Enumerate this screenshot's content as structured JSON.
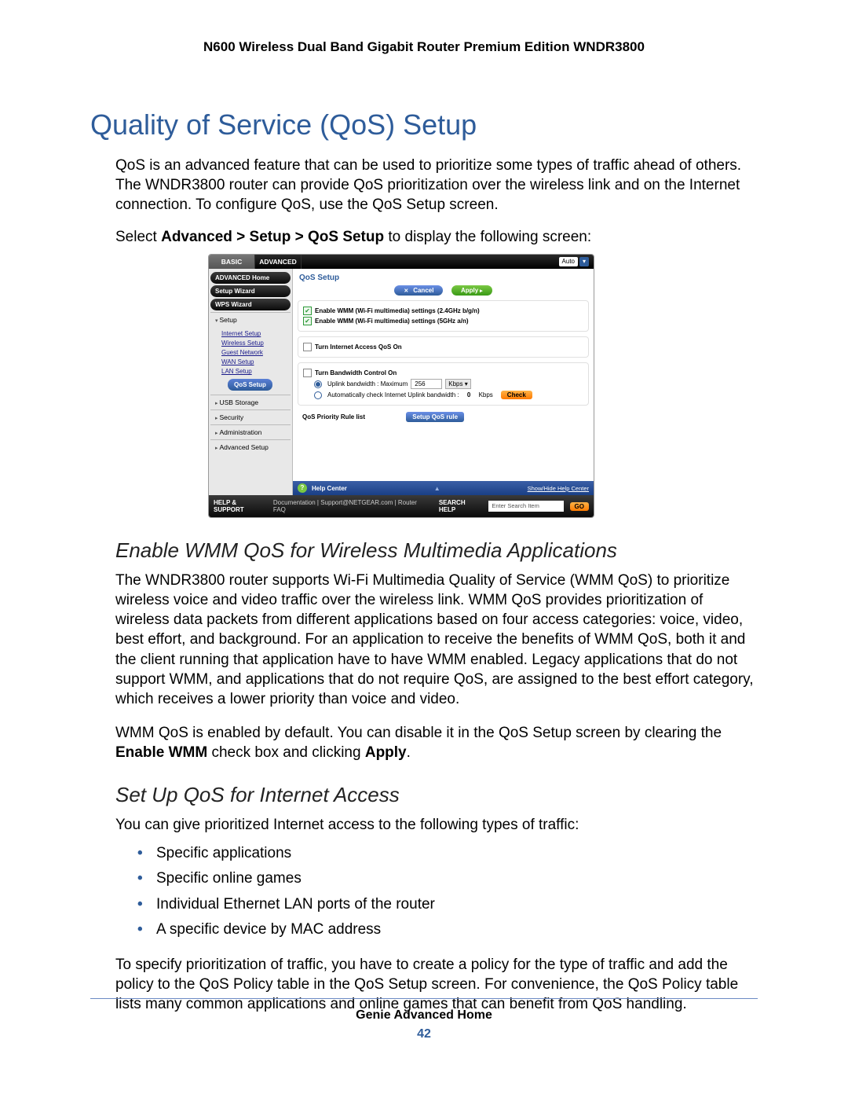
{
  "doc_header": "N600 Wireless Dual Band Gigabit Router Premium Edition WNDR3800",
  "page_title": "Quality of Service (QoS) Setup",
  "intro": "QoS is an advanced feature that can be used to prioritize some types of traffic ahead of others. The WNDR3800 router can provide QoS prioritization over the wireless link and on the Internet connection. To configure QoS, use the QoS Setup screen.",
  "nav_pre": "Select ",
  "nav_bold": "Advanced > Setup > QoS Setup",
  "nav_post": " to display the following screen:",
  "ui": {
    "tab_basic": "BASIC",
    "tab_advanced": "ADVANCED",
    "auto_label": "Auto",
    "side_home": "ADVANCED Home",
    "side_setup_wiz": "Setup Wizard",
    "side_wps_wiz": "WPS Wizard",
    "side_setup": "Setup",
    "side_links": {
      "internet": "Internet Setup",
      "wireless": "Wireless Setup",
      "guest": "Guest Network",
      "wan": "WAN Setup",
      "lan": "LAN Setup"
    },
    "side_active": "QoS Setup",
    "side_usb": "USB Storage",
    "side_security": "Security",
    "side_admin": "Administration",
    "side_advsetup": "Advanced Setup",
    "main_title": "QoS Setup",
    "btn_cancel": "Cancel",
    "btn_apply": "Apply",
    "wmm24": "Enable WMM (Wi-Fi multimedia) settings (2.4GHz b/g/n)",
    "wmm5": "Enable WMM (Wi-Fi multimedia) settings (5GHz a/n)",
    "qos_on": "Turn Internet Access QoS On",
    "bw_on": "Turn Bandwidth Control On",
    "uplink_label": "Uplink bandwidth :   Maximum",
    "uplink_value": "256",
    "uplink_unit": "Kbps",
    "auto_uplink": "Automatically check Internet Uplink bandwidth :",
    "auto_uplink_value": "0",
    "auto_uplink_unit": "Kbps",
    "check_btn": "Check",
    "rule_list": "QoS Priority Rule list",
    "setup_rule_btn": "Setup QoS rule",
    "help_center": "Help Center",
    "showhide": "Show/Hide Help Center",
    "hs_label": "HELP & SUPPORT",
    "hs_links": "Documentation | Support@NETGEAR.com | Router FAQ",
    "search_label": "SEARCH HELP",
    "search_ph": "Enter Search Item",
    "go": "GO"
  },
  "sub1_title": "Enable WMM QoS for Wireless Multimedia Applications",
  "sub1_p1": "The WNDR3800 router supports Wi-Fi Multimedia Quality of Service (WMM QoS) to prioritize wireless voice and video traffic over the wireless link. WMM QoS provides prioritization of wireless data packets from different applications based on four access categories: voice, video, best effort, and background. For an application to receive the benefits of WMM QoS, both it and the client running that application have to have WMM enabled. Legacy applications that do not support WMM, and applications that do not require QoS, are assigned to the best effort category, which receives a lower priority than voice and video.",
  "sub1_p2a": "WMM QoS is enabled by default. You can disable it in the QoS Setup screen by clearing the ",
  "sub1_p2b": "Enable WMM",
  "sub1_p2c": " check box and clicking ",
  "sub1_p2d": "Apply",
  "sub1_p2e": ".",
  "sub2_title": "Set Up QoS for Internet Access",
  "sub2_lead": "You can give prioritized Internet access to the following types of traffic:",
  "bullets": [
    "Specific applications",
    "Specific online games",
    "Individual Ethernet LAN ports of the router",
    "A specific device by MAC address"
  ],
  "sub2_tail": "To specify prioritization of traffic, you have to create a policy for the type of traffic and add the policy to the QoS Policy table in the QoS Setup screen. For convenience, the QoS Policy table lists many common applications and online games that can benefit from QoS handling.",
  "footer_chapter": "Genie Advanced Home",
  "footer_page": "42"
}
